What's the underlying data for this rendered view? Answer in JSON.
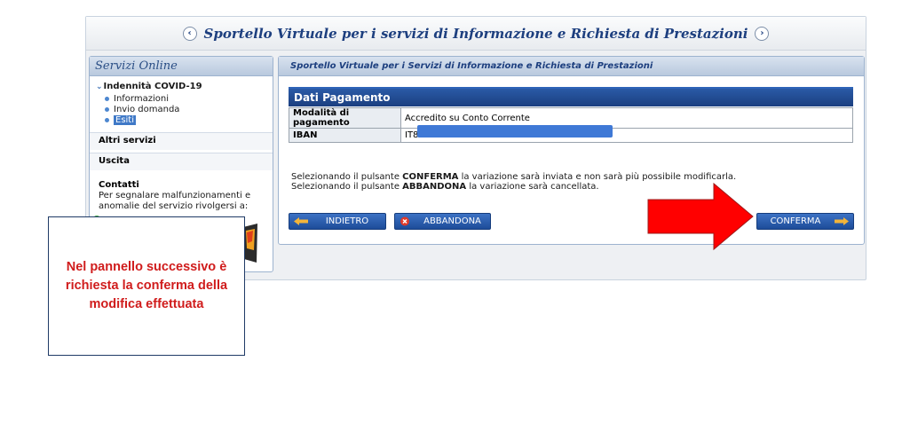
{
  "banner": {
    "title": "Sportello Virtuale per i servizi di Informazione e Richiesta di Prestazioni",
    "prev": "‹",
    "next": "›"
  },
  "sidebar": {
    "title": "Servizi Online",
    "covid": {
      "chevron": "⌄",
      "title": "Indennità COVID-19",
      "items": [
        "Informazioni",
        "Invio domanda",
        "Esiti"
      ]
    },
    "altri": "Altri servizi",
    "uscita": "Uscita",
    "contatti": {
      "title": "Contatti",
      "text": "Per segnalare malfunzionamenti e anomalie del servizio rivolgersi a:"
    }
  },
  "main": {
    "header": "Sportello Virtuale per i Servizi di Informazione e Richiesta di Prestazioni",
    "dati": {
      "title": "Dati Pagamento",
      "rows": [
        {
          "label": "Modalità di pagamento",
          "value": "Accredito su Conto Corrente"
        },
        {
          "label": "IBAN",
          "value": "IT8"
        }
      ]
    },
    "info": {
      "line1_pre": "Selezionando il pulsante ",
      "line1_bold": "CONFERMA",
      "line1_post": " la variazione sarà inviata e non sarà più possibile modificarla.",
      "line2_pre": "Selezionando il pulsante ",
      "line2_bold": "ABBANDONA",
      "line2_post": " la variazione sarà cancellata."
    },
    "buttons": {
      "indietro": "INDIETRO",
      "abbandona": "ABBANDONA",
      "conferma": "CONFERMA"
    }
  },
  "callout": {
    "text": "Nel pannello successivo è richiesta la conferma della modifica effettuata"
  },
  "colors": {
    "accent": "#1d3f7f",
    "callout_text": "#d01c1c",
    "arrow": "#ff0000",
    "iban_mask": "#3f79d6"
  }
}
